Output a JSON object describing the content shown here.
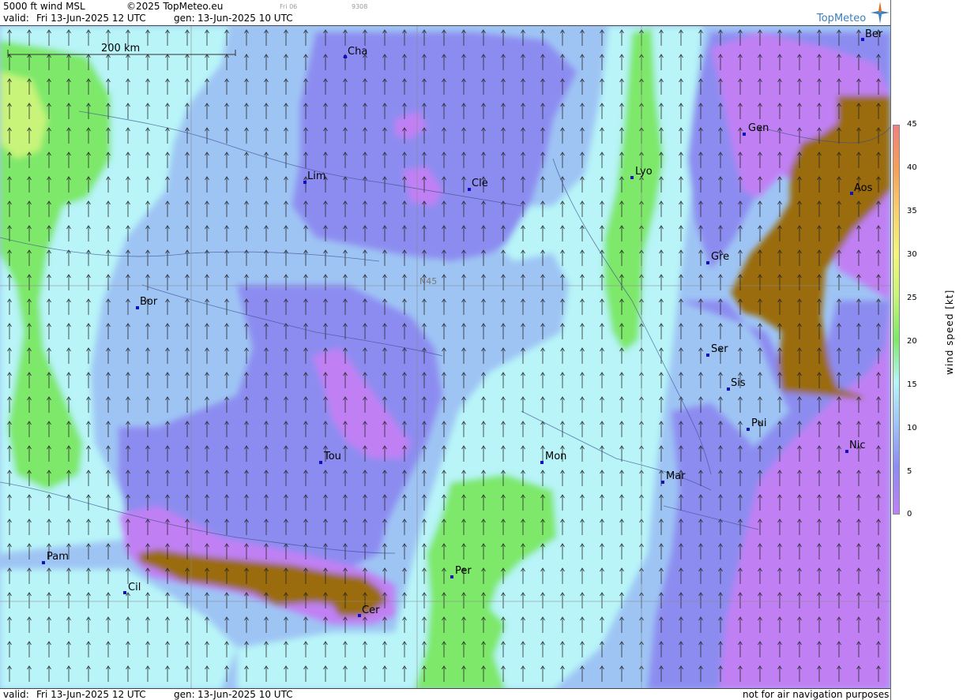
{
  "header": {
    "title": "5000 ft wind MSL",
    "copyright": "©2025 TopMeteo.eu",
    "day_tag": "Fri 06",
    "code": "9308",
    "valid_label": "valid:",
    "valid_value": "Fri  13-Jun-2025  12 UTC",
    "gen_label": "gen:",
    "gen_value": "13-Jun-2025 10 UTC",
    "logo_text": "TopMeteo"
  },
  "footer": {
    "valid_label": "valid:",
    "valid_value": "Fri  13-Jun-2025  12 UTC",
    "gen_label": "gen:",
    "gen_value": "13-Jun-2025 10 UTC",
    "disclaimer": "not for air navigation purposes"
  },
  "map": {
    "scale_label": "200 km",
    "lat_label": "N45",
    "cities": [
      {
        "code": "Cha"
      },
      {
        "code": "Lim"
      },
      {
        "code": "Cle"
      },
      {
        "code": "Lyo"
      },
      {
        "code": "Gen"
      },
      {
        "code": "Ber"
      },
      {
        "code": "Aos"
      },
      {
        "code": "Gre"
      },
      {
        "code": "Bor"
      },
      {
        "code": "Ser"
      },
      {
        "code": "Sis"
      },
      {
        "code": "Pui"
      },
      {
        "code": "Tou"
      },
      {
        "code": "Mon"
      },
      {
        "code": "Mar"
      },
      {
        "code": "Nic"
      },
      {
        "code": "Pam"
      },
      {
        "code": "Cil"
      },
      {
        "code": "Per"
      },
      {
        "code": "Cer"
      }
    ],
    "wind_direction": "north"
  },
  "legend": {
    "title": "wind speed [kt]",
    "ticks": [
      "45",
      "40",
      "35",
      "30",
      "25",
      "20",
      "15",
      "10",
      "5",
      "0"
    ],
    "colors": [
      "#f08080",
      "#f4a05a",
      "#f7d070",
      "#f4f47a",
      "#c8f47a",
      "#7ee86a",
      "#b8f4f8",
      "#9ec4f4",
      "#8c8cf0",
      "#c080f4"
    ]
  }
}
